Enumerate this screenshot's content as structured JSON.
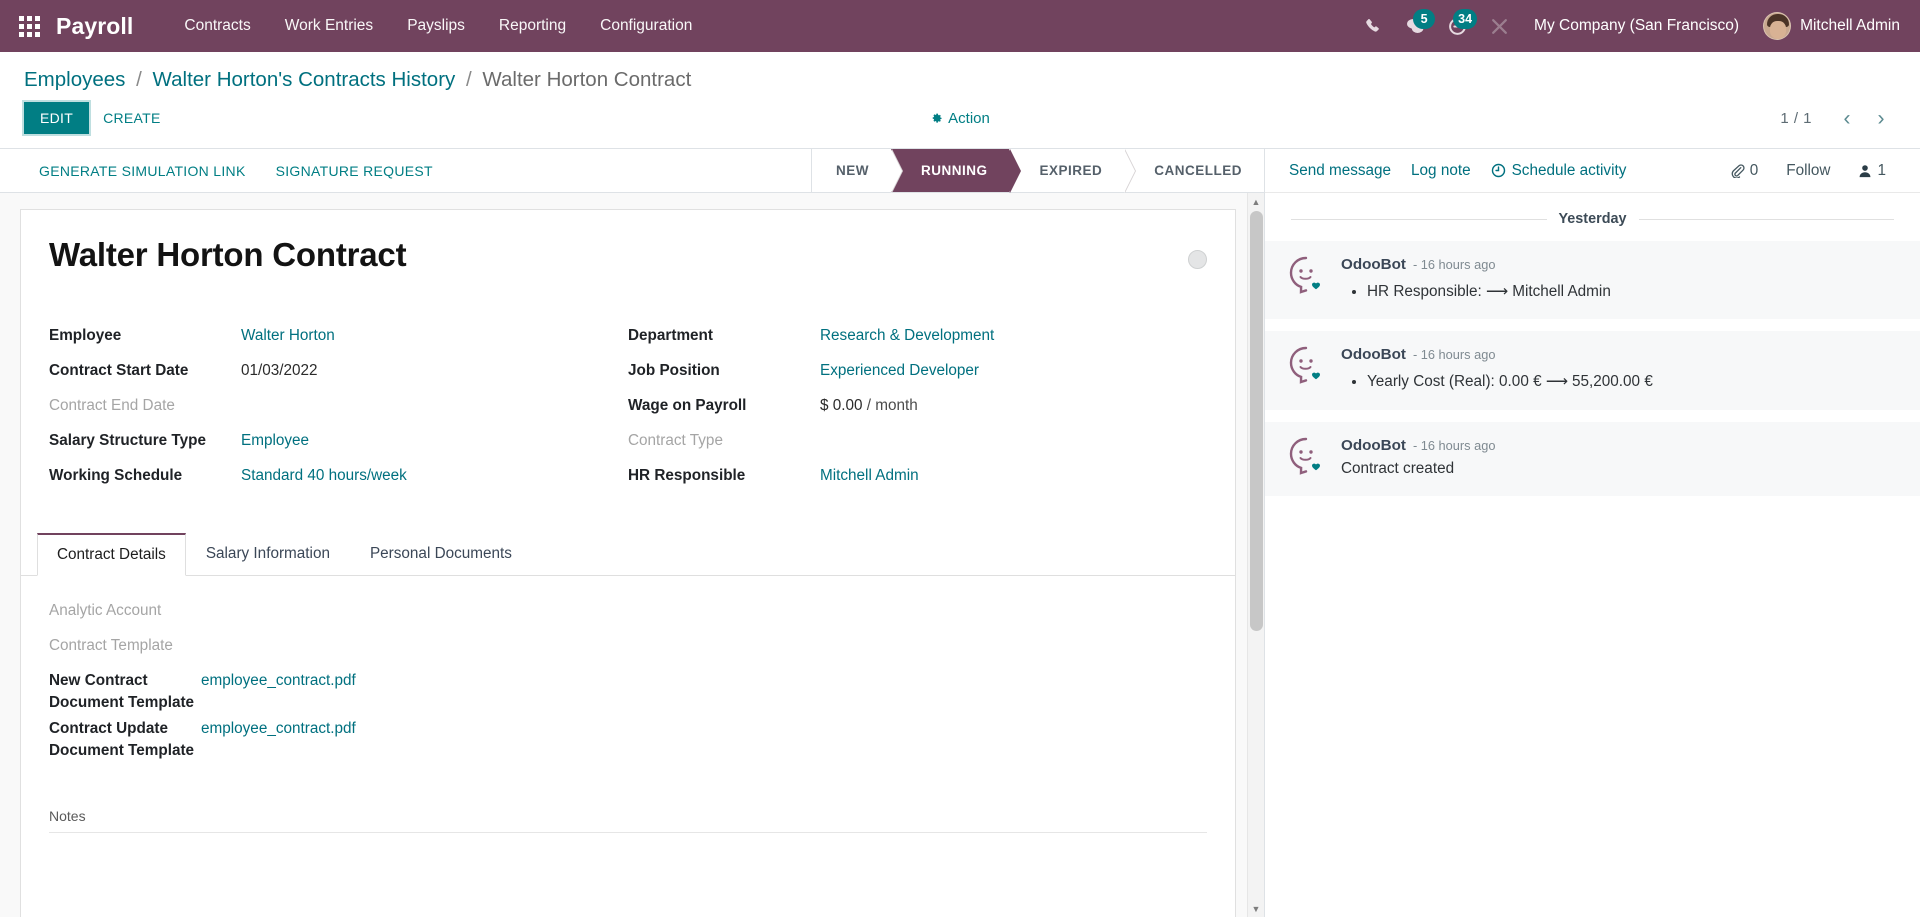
{
  "navbar": {
    "apps_icon": "apps-grid-icon",
    "brand": "Payroll",
    "menu": [
      {
        "label": "Contracts"
      },
      {
        "label": "Work Entries"
      },
      {
        "label": "Payslips"
      },
      {
        "label": "Reporting"
      },
      {
        "label": "Configuration"
      }
    ],
    "icons": {
      "phone": "phone-icon",
      "messages": "chat-bubble-icon",
      "messages_count": "5",
      "activities": "clock-icon",
      "activities_count": "34",
      "tools": "wrench-screwdriver-icon"
    },
    "company": "My Company (San Francisco)",
    "user": "Mitchell Admin",
    "bg_color": "#71435e",
    "badge_color": "#017e84"
  },
  "breadcrumb": {
    "items": [
      {
        "label": "Employees",
        "current": false
      },
      {
        "label": "Walter Horton's Contracts History",
        "current": false
      },
      {
        "label": "Walter Horton Contract",
        "current": true
      }
    ],
    "separator": "/"
  },
  "control_panel": {
    "edit_label": "EDIT",
    "create_label": "CREATE",
    "action_label": "Action",
    "action_icon": "gear-icon",
    "pager_value": "1 / 1",
    "prev_icon": "chevron-left-icon",
    "next_icon": "chevron-right-icon"
  },
  "statusbar": {
    "buttons": [
      {
        "label": "GENERATE SIMULATION LINK"
      },
      {
        "label": "SIGNATURE REQUEST"
      }
    ],
    "stages": [
      {
        "label": "NEW",
        "active": false
      },
      {
        "label": "RUNNING",
        "active": true
      },
      {
        "label": "EXPIRED",
        "active": false
      },
      {
        "label": "CANCELLED",
        "active": false
      }
    ],
    "active_color": "#71435e"
  },
  "form": {
    "title": "Walter Horton Contract",
    "kanban_state_icon": "circle-state-icon",
    "fields_left": [
      {
        "label": "Employee",
        "value": "Walter Horton",
        "link": true,
        "muted": false
      },
      {
        "label": "Contract Start Date",
        "value": "01/03/2022",
        "link": false,
        "muted": false
      },
      {
        "label": "Contract End Date",
        "value": "",
        "link": false,
        "muted": true
      },
      {
        "label": "Salary Structure Type",
        "value": "Employee",
        "link": true,
        "muted": false
      },
      {
        "label": "Working Schedule",
        "value": "Standard 40 hours/week",
        "link": true,
        "muted": false
      }
    ],
    "fields_right": [
      {
        "label": "Department",
        "value": "Research & Development",
        "link": true,
        "muted": false
      },
      {
        "label": "Job Position",
        "value": "Experienced Developer",
        "link": true,
        "muted": false
      },
      {
        "label": "Wage on Payroll",
        "value": "$ 0.00",
        "suffix": "/ month",
        "link": false,
        "muted": false
      },
      {
        "label": "Contract Type",
        "value": "",
        "link": false,
        "muted": true
      },
      {
        "label": "HR Responsible",
        "value": "Mitchell Admin",
        "link": true,
        "muted": false
      }
    ],
    "tabs": [
      {
        "label": "Contract Details",
        "active": true
      },
      {
        "label": "Salary Information",
        "active": false
      },
      {
        "label": "Personal Documents",
        "active": false
      }
    ],
    "tab_fields": [
      {
        "label": "Analytic Account",
        "value": "",
        "link": false,
        "muted": true,
        "two_line": false
      },
      {
        "label": "Contract Template",
        "value": "",
        "link": false,
        "muted": true,
        "two_line": false
      },
      {
        "label": "New Contract\nDocument Template",
        "value": "employee_contract.pdf",
        "link": true,
        "muted": false,
        "two_line": true
      },
      {
        "label": "Contract Update\nDocument Template",
        "value": "employee_contract.pdf",
        "link": true,
        "muted": false,
        "two_line": true
      }
    ],
    "notes_label": "Notes"
  },
  "chatter": {
    "send_message": "Send message",
    "log_note": "Log note",
    "schedule_activity": "Schedule activity",
    "schedule_icon": "clock-icon",
    "attachment_icon": "paperclip-icon",
    "attachment_count": "0",
    "follow_label": "Follow",
    "followers_icon": "user-icon",
    "followers_count": "1",
    "day_separator": "Yesterday",
    "messages": [
      {
        "author": "OdooBot",
        "time": "- 16 hours ago",
        "avatar": "odoobot-avatar",
        "bullets": [
          "HR Responsible: ⟶ Mitchell Admin"
        ],
        "plain": ""
      },
      {
        "author": "OdooBot",
        "time": "- 16 hours ago",
        "avatar": "odoobot-avatar",
        "bullets": [
          "Yearly Cost (Real): 0.00 € ⟶ 55,200.00 €"
        ],
        "plain": ""
      },
      {
        "author": "OdooBot",
        "time": "- 16 hours ago",
        "avatar": "odoobot-avatar",
        "bullets": [],
        "plain": "Contract created"
      }
    ]
  }
}
